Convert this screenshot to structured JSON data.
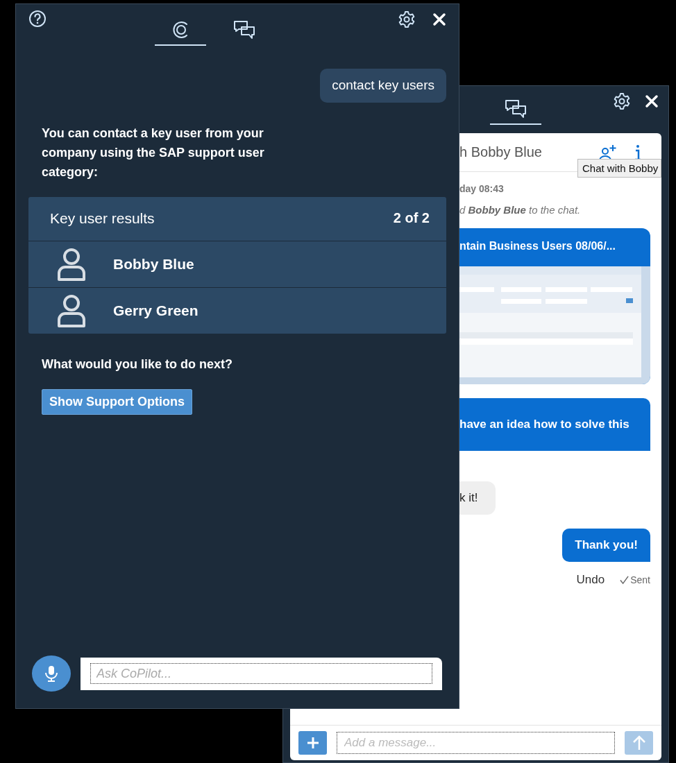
{
  "copilot_window": {
    "tabs": [
      {
        "kind": "copilot",
        "selected": true
      },
      {
        "kind": "chat",
        "selected": false
      }
    ],
    "messages": [
      {
        "kind": "user",
        "text": "contact key users"
      },
      {
        "kind": "bot",
        "text": "You can contact a key user from your company using the SAP support user category:"
      }
    ],
    "results": {
      "title": "Key user results",
      "count": "2 of 2",
      "users": [
        {
          "name": "Bobby Blue"
        },
        {
          "name": "Gerry Green"
        }
      ]
    },
    "prompt": "What would you like to do next?",
    "action_button": "Show Support Options",
    "input": {
      "placeholder": "Ask CoPilot..."
    }
  },
  "chat_window": {
    "tabs": [
      {
        "kind": "chat",
        "selected": true
      }
    ],
    "title": "h Bobby Blue",
    "tooltip": "Chat with Bobby",
    "timestamp": "day 08:43",
    "system_note": "d **Bobby Blue** to the chat.",
    "messages": [
      {
        "kind": "attachment",
        "title": "ntain Business Users 08/06/..."
      },
      {
        "kind": "sent",
        "text": "have an idea how to solve this"
      },
      {
        "kind": "received",
        "text": "k it!"
      },
      {
        "kind": "sent",
        "text": "Thank you!"
      }
    ],
    "undo": "Undo",
    "status": "Sent",
    "composer": {
      "placeholder": "Add a message...",
      "send_disabled": true
    }
  }
}
